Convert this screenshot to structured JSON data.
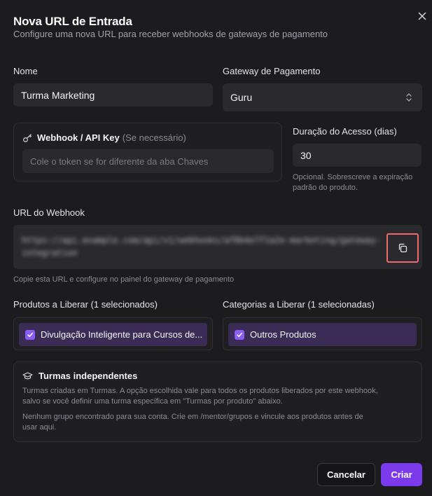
{
  "dialog": {
    "title": "Nova URL de Entrada",
    "subtitle": "Configure uma nova URL para receber webhooks de gateways de pagamento"
  },
  "form": {
    "name_label": "Nome",
    "name_value": "Turma Marketing",
    "gateway_label": "Gateway de Pagamento",
    "gateway_value": "Guru",
    "apikey_label": "Webhook / API Key",
    "apikey_optional": "(Se necessário)",
    "apikey_placeholder": "Cole o token se for diferente da aba Chaves",
    "duration_label": "Duração do Acesso (dias)",
    "duration_value": "30",
    "duration_hint_line1": "Opcional. Sobrescreve a expiração",
    "duration_hint_line2": "padrão do produto.",
    "webhook_url_label": "URL do Webhook",
    "webhook_url_value": "https://api.example.com/api/v1/webhooks/af8b4e7f1a2e-marketing/gateway-integration",
    "webhook_url_hint": "Copie esta URL e configure no painel do gateway de pagamento"
  },
  "products": {
    "label": "Produtos a Liberar (1 selecionados)",
    "items": [
      "Divulgação Inteligente para Cursos de..."
    ]
  },
  "categories": {
    "label": "Categorias a Liberar (1 selecionadas)",
    "items": [
      "Outros Produtos"
    ]
  },
  "turmas": {
    "title": "Turmas independentes",
    "desc_line1": "Turmas criadas em Turmas. A opção escolhida vale para todos os produtos liberados por este webhook,",
    "desc_line2": "salvo se você definir uma turma específica em \"Turmas por produto\" abaixo.",
    "note_line1": "Nenhum grupo encontrado para sua conta. Crie em /mentor/grupos e vincule aos produtos antes de",
    "note_line2": "usar aqui."
  },
  "actions": {
    "cancel": "Cancelar",
    "create": "Criar"
  },
  "colors": {
    "accent": "#7c3aed",
    "chip_bg": "#3a2c54",
    "highlight": "#f16a6a"
  },
  "icons": [
    "close-icon",
    "key-icon",
    "chevron-updown-icon",
    "copy-icon",
    "check-icon",
    "graduation-cap-icon"
  ]
}
